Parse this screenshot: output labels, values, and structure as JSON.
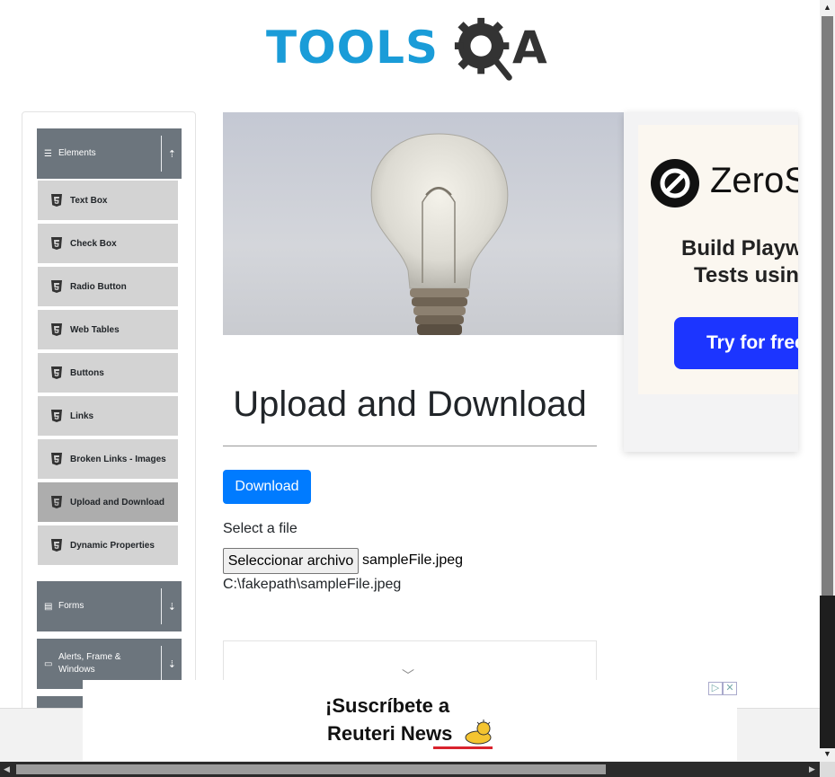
{
  "logo": {
    "text": "TOOLS",
    "suffix": "A"
  },
  "sidebar": {
    "groups": [
      {
        "label": "Elements",
        "icon": "hamburger-icon",
        "arrow": "collapse-up-icon"
      },
      {
        "label": "Forms",
        "icon": "list-icon",
        "arrow": "expand-down-icon"
      },
      {
        "label": "Alerts, Frame & Windows",
        "icon": "window-icon",
        "arrow": "expand-down-icon"
      }
    ],
    "items": [
      {
        "label": "Text Box"
      },
      {
        "label": "Check Box"
      },
      {
        "label": "Radio Button"
      },
      {
        "label": "Web Tables"
      },
      {
        "label": "Buttons"
      },
      {
        "label": "Links"
      },
      {
        "label": "Broken Links - Images"
      },
      {
        "label": "Upload and Download",
        "active": true
      },
      {
        "label": "Dynamic Properties"
      }
    ]
  },
  "ad": {
    "brand": "ZeroS",
    "line1": "Build Playwr",
    "line2": "Tests using",
    "button": "Try for free",
    "button_color": "#1c35ff"
  },
  "main": {
    "title": "Upload and Download",
    "download_button": "Download",
    "select_label": "Select a file",
    "file_button": "Seleccionar archivo",
    "file_name": "sampleFile.jpeg",
    "file_path": "C:\\fakepath\\sampleFile.jpeg"
  },
  "bottom_ad": {
    "line1": "¡Suscríbete a",
    "line2": "Reuteri News",
    "choice_icons": [
      "ad-choices-icon",
      "ad-close-icon"
    ]
  },
  "colors": {
    "accent": "#007bff",
    "sidebar_header": "#6c757d",
    "sidebar_item": "#d3d3d3",
    "sidebar_item_active": "#adadad",
    "logo_blue": "#1a9cd8"
  }
}
